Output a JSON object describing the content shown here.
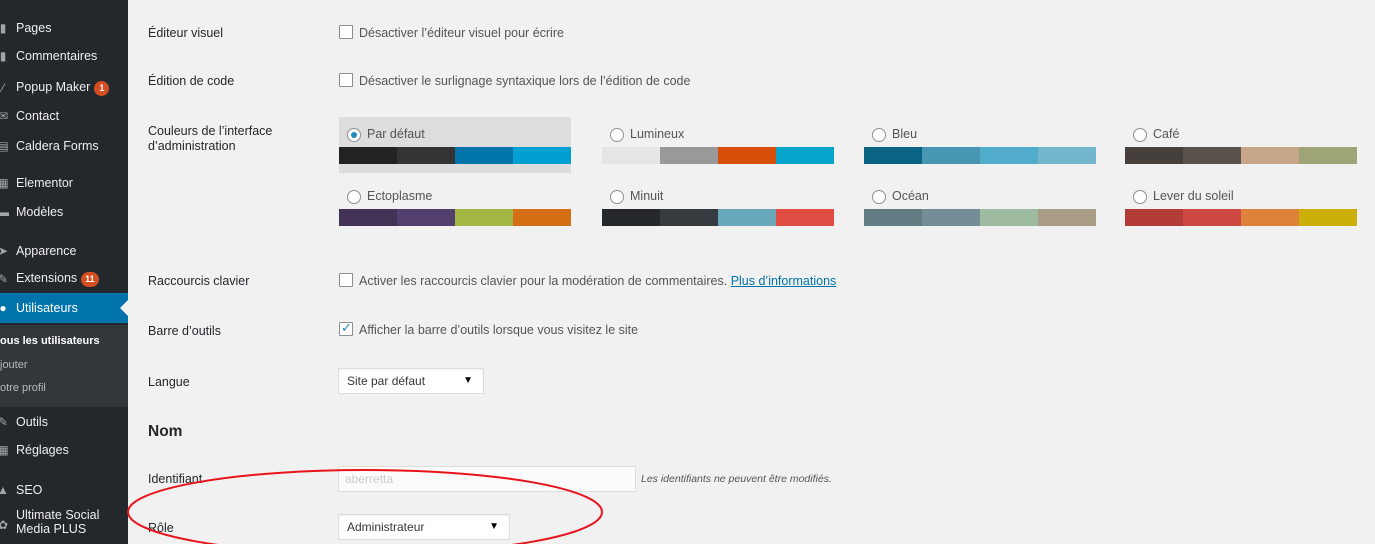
{
  "sidebar": {
    "items": [
      {
        "label": "Pages",
        "icon": "pages-icon",
        "badge": ""
      },
      {
        "label": "Commentaires",
        "icon": "comments-icon",
        "badge": ""
      },
      {
        "label": "Popup Maker",
        "icon": "popup-icon",
        "badge": "1"
      },
      {
        "label": "Contact",
        "icon": "mail-icon",
        "badge": ""
      },
      {
        "label": "Caldera Forms",
        "icon": "forms-icon",
        "badge": ""
      },
      {
        "label": "Elementor",
        "icon": "elementor-icon",
        "badge": ""
      },
      {
        "label": "Modèles",
        "icon": "templates-icon",
        "badge": ""
      },
      {
        "label": "Apparence",
        "icon": "appearance-icon",
        "badge": ""
      },
      {
        "label": "Extensions",
        "icon": "plugins-icon",
        "badge": "11"
      },
      {
        "label": "Utilisateurs",
        "icon": "users-icon",
        "badge": ""
      },
      {
        "label": "Outils",
        "icon": "tools-icon",
        "badge": ""
      },
      {
        "label": "Réglages",
        "icon": "settings-icon",
        "badge": ""
      },
      {
        "label": "SEO",
        "icon": "seo-icon",
        "badge": ""
      },
      {
        "label": "Ultimate Social\nMedia PLUS",
        "icon": "social-icon",
        "badge": ""
      }
    ],
    "submenu": [
      {
        "label": "ous les utilisateurs"
      },
      {
        "label": "jouter"
      },
      {
        "label": "otre profil"
      }
    ]
  },
  "form": {
    "visual_editor": {
      "label": "Éditeur visuel",
      "checkbox": "Désactiver l’éditeur visuel pour écrire",
      "checked": false
    },
    "code_editing": {
      "label": "Édition de code",
      "checkbox": "Désactiver le surlignage syntaxique lors de l’édition de code",
      "checked": false
    },
    "color_scheme": {
      "label": "Couleurs de l’interface d’administration",
      "schemes": [
        {
          "name": "Par défaut",
          "selected": true,
          "colors": [
            "#222222",
            "#333333",
            "#0073aa",
            "#00a0d2"
          ]
        },
        {
          "name": "Lumineux",
          "selected": false,
          "colors": [
            "#e5e5e5",
            "#999999",
            "#d64e07",
            "#04a4cc"
          ]
        },
        {
          "name": "Bleu",
          "selected": false,
          "colors": [
            "#096484",
            "#4796b3",
            "#52accc",
            "#74b6ce"
          ]
        },
        {
          "name": "Café",
          "selected": false,
          "colors": [
            "#46403c",
            "#59524c",
            "#c7a589",
            "#9ea476"
          ]
        },
        {
          "name": "Ectoplasme",
          "selected": false,
          "colors": [
            "#413256",
            "#523f6d",
            "#a3b745",
            "#d46f15"
          ]
        },
        {
          "name": "Minuit",
          "selected": false,
          "colors": [
            "#25282b",
            "#363b3f",
            "#69a8bb",
            "#e14d43"
          ]
        },
        {
          "name": "Océan",
          "selected": false,
          "colors": [
            "#627c83",
            "#738e96",
            "#9ebaa0",
            "#aa9d88"
          ]
        },
        {
          "name": "Lever du soleil",
          "selected": false,
          "colors": [
            "#b43c38",
            "#cf4944",
            "#dd823b",
            "#ccaf0b"
          ]
        }
      ]
    },
    "keyboard_shortcuts": {
      "label": "Raccourcis clavier",
      "checkbox": "Activer les raccourcis clavier pour la modération de commentaires.",
      "link": "Plus d’informations",
      "checked": false
    },
    "toolbar": {
      "label": "Barre d’outils",
      "checkbox": "Afficher la barre d’outils lorsque vous visitez le site",
      "checked": true
    },
    "language": {
      "label": "Langue",
      "value": "Site par défaut"
    },
    "name_section": {
      "title": "Nom"
    },
    "username": {
      "label": "Identifiant",
      "value": "aberretta",
      "description": "Les identifiants ne peuvent être modifiés."
    },
    "role": {
      "label": "Rôle",
      "value": "Administrateur"
    }
  },
  "colors": {
    "annotation": "#e8141c",
    "accent": "#0073aa"
  }
}
